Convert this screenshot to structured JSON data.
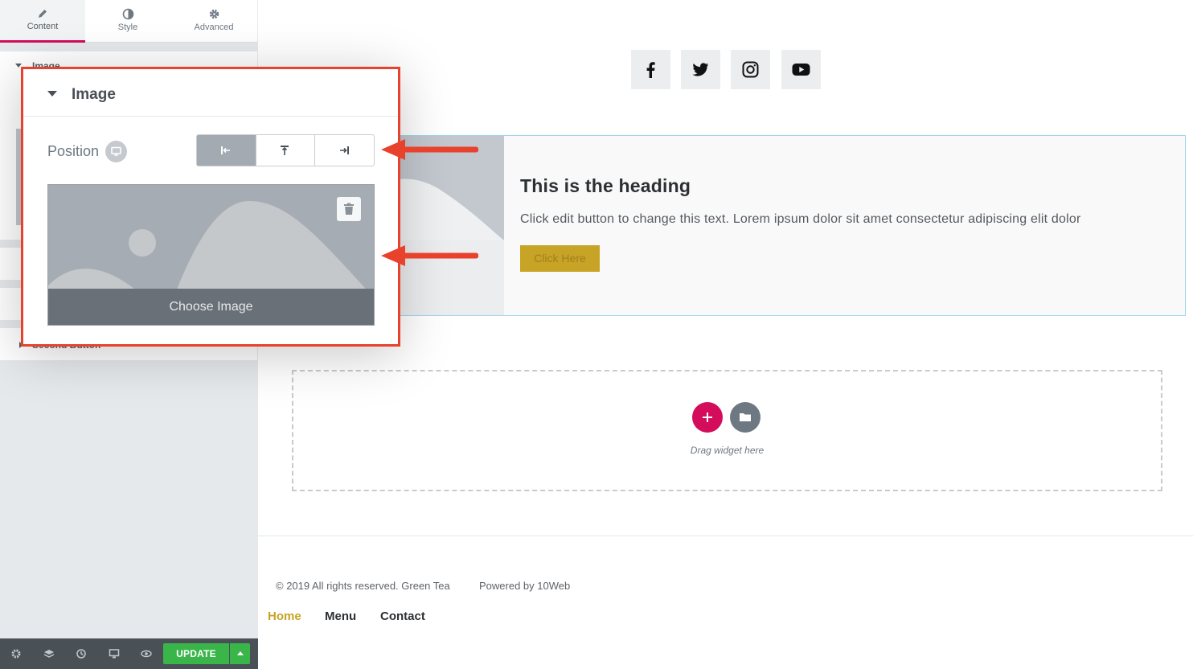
{
  "panel": {
    "tabs": [
      {
        "label": "Content",
        "icon": "pencil-icon",
        "active": true
      },
      {
        "label": "Style",
        "icon": "half-circle-icon",
        "active": false
      },
      {
        "label": "Advanced",
        "icon": "gear-icon",
        "active": false
      }
    ],
    "under_section_label": "Image",
    "under_second_label": "Second Button",
    "update_label": "UPDATE",
    "accent": "#d30c5c",
    "update_color": "#39b54a"
  },
  "callout": {
    "section_title": "Image",
    "position_label": "Position",
    "position_options": [
      {
        "icon": "align-left-icon",
        "selected": true
      },
      {
        "icon": "align-top-icon",
        "selected": false
      },
      {
        "icon": "align-right-icon",
        "selected": false
      }
    ],
    "choose_image_label": "Choose Image",
    "border_color": "#e8412c"
  },
  "canvas": {
    "social_icons": [
      "facebook-icon",
      "twitter-icon",
      "instagram-icon",
      "youtube-icon"
    ],
    "heading": "This is the heading",
    "body_text": "Click edit button to change this text. Lorem ipsum dolor sit amet consectetur adipiscing elit dolor",
    "button_label": "Click Here",
    "drag_hint": "Drag widget here",
    "footer": {
      "copyright": "© 2019 All rights reserved. Green Tea",
      "powered": "Powered by 10Web",
      "nav": [
        "Home",
        "Menu",
        "Contact"
      ]
    },
    "button_color": "#c7a425"
  }
}
